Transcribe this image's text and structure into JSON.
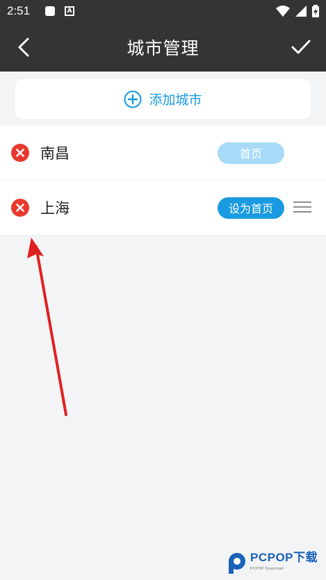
{
  "status_bar": {
    "time": "2:51",
    "icons": [
      "notification-square-icon",
      "a-badge-icon",
      "wifi-icon",
      "signal-icon",
      "battery-charging-icon"
    ]
  },
  "header": {
    "title": "城市管理",
    "back_icon": "chevron-left-icon",
    "confirm_icon": "check-icon"
  },
  "add_city": {
    "label": "添加城市",
    "icon": "plus-circle-icon"
  },
  "cities": [
    {
      "name": "南昌",
      "home_label": "首页",
      "is_home": true
    },
    {
      "name": "上海",
      "home_label": "设为首页",
      "is_home": false
    }
  ],
  "colors": {
    "header_bg": "#343434",
    "accent": "#1a9ae0",
    "accent_light": "#a7daf7",
    "delete_red": "#e8392f",
    "page_bg": "#f3f4f6",
    "annotation_arrow": "#e02020"
  },
  "watermark": {
    "brand": "PCPOP下载",
    "sub": "PCPOP Download"
  }
}
